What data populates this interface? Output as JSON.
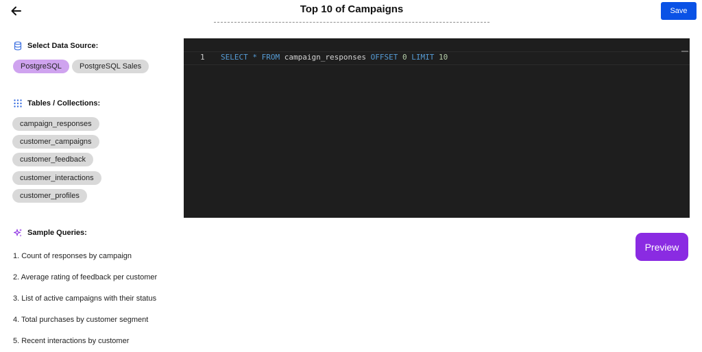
{
  "header": {
    "title": "Top 10 of Campaigns",
    "save_label": "Save"
  },
  "data_source": {
    "heading": "Select Data Source:",
    "options": [
      {
        "label": "PostgreSQL",
        "selected": true
      },
      {
        "label": "PostgreSQL Sales",
        "selected": false
      }
    ]
  },
  "tables": {
    "heading": "Tables / Collections:",
    "items": [
      "campaign_responses",
      "customer_campaigns",
      "customer_feedback",
      "customer_interactions",
      "customer_profiles"
    ]
  },
  "samples": {
    "heading": "Sample Queries:",
    "items": [
      "1. Count of responses by campaign",
      "2. Average rating of feedback per customer",
      "3. List of active campaigns with their status",
      "4. Total purchases by customer segment",
      "5. Recent interactions by customer"
    ]
  },
  "editor": {
    "line_number": "1",
    "tokens": {
      "select": "SELECT",
      "star": "*",
      "from": "FROM",
      "table": "campaign_responses",
      "offset": "OFFSET",
      "offset_val": "0",
      "limit": "LIMIT",
      "limit_val": "10"
    }
  },
  "preview_label": "Preview",
  "colors": {
    "save": "#0a52e6",
    "preview": "#8a2be2",
    "selected_pill": "#cfa3ef",
    "pill": "#d9d9d9",
    "editor_bg": "#1e1e1e"
  },
  "icons": {
    "back": "arrow-left-icon",
    "data_source": "database-icon",
    "tables": "grid-dots-icon",
    "samples": "sparkles-icon"
  }
}
